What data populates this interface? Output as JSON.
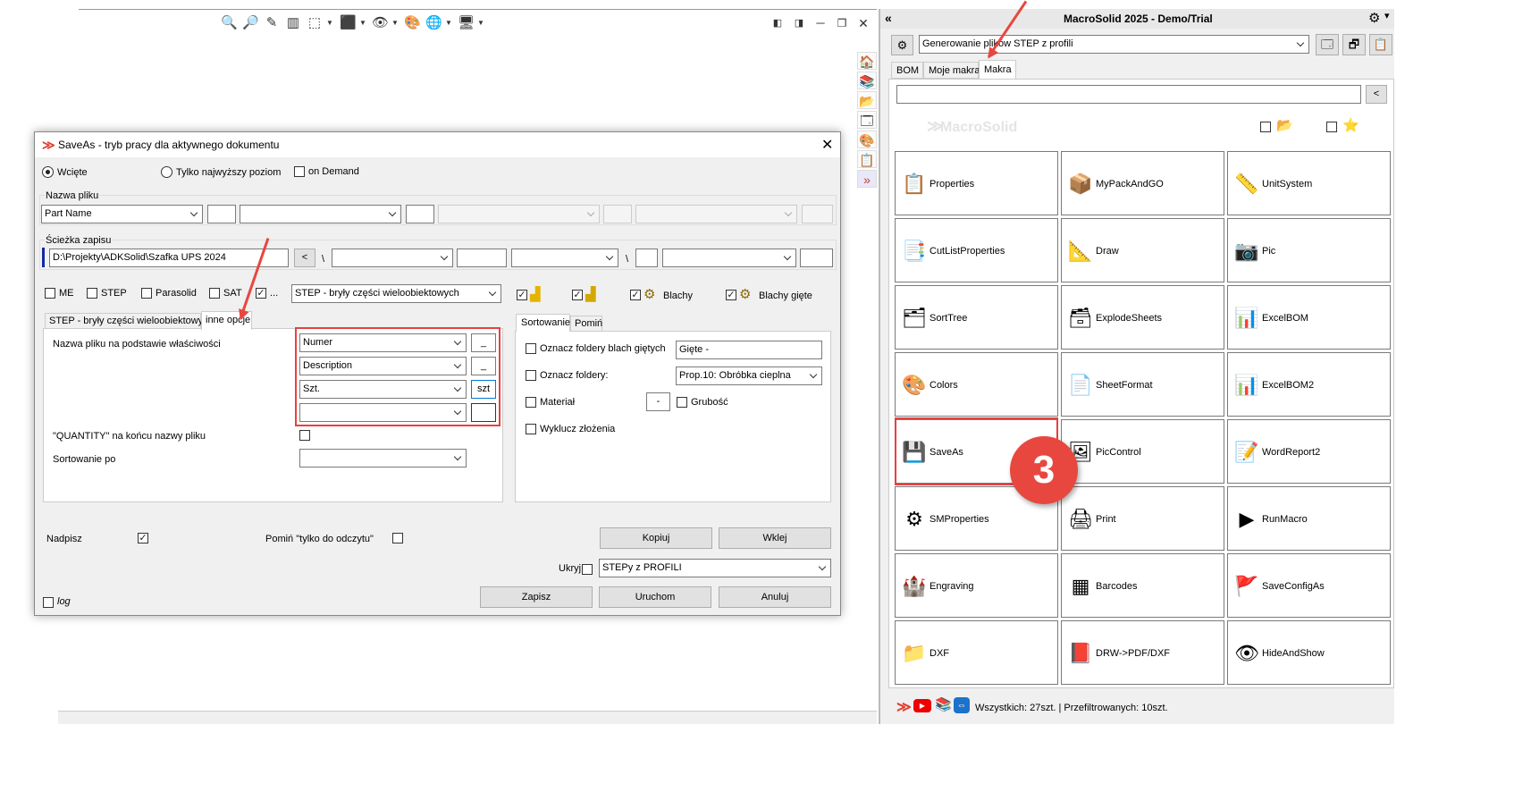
{
  "toolbar": {
    "icons": [
      "zoom-to-fit-icon",
      "zoom-area-icon",
      "previous-view-icon",
      "section-view-icon",
      "view-orientation-icon",
      "display-style-icon",
      "hide-show-icon",
      "edit-appearance-icon",
      "apply-scene-icon",
      "view-settings-icon"
    ]
  },
  "dialog": {
    "title": "SaveAs - tryb pracy dla aktywnego dokumentu",
    "radio_mode": {
      "wciete": "Wcięte",
      "top_level": "Tylko najwyższy poziom",
      "on_demand": "on Demand"
    },
    "file_name": {
      "section_label": "Nazwa pliku",
      "field1": "Part Name"
    },
    "save_path": {
      "section_label": "Ścieżka zapisu",
      "path": "D:\\Projekty\\ADKSolid\\Szafka UPS 2024",
      "back_label": "<",
      "sep": "\\"
    },
    "formats": {
      "me": "ME",
      "step": "STEP",
      "parasolid": "Parasolid",
      "sat": "SAT",
      "more": "...",
      "selected": "STEP - bryły części wieloobiektowych",
      "blachy": "Blachy",
      "blachy_giete": "Blachy gięte"
    },
    "tabs_left": {
      "tab1": "STEP - bryły części wieloobiektowych",
      "tab2": "inne opcje"
    },
    "options": {
      "name_by_props_label": "Nazwa pliku na podstawie właściwości",
      "prop1": "Numer",
      "prop2": "Description",
      "prop3": "Szt.",
      "prop4": "",
      "sep1": "_",
      "sep2": "_",
      "sep3": "szt",
      "sep4": "",
      "quantity_label": "\"QUANTITY\" na końcu nazwy pliku",
      "sort_label": "Sortowanie po",
      "sort_value": ""
    },
    "tabs_right": {
      "tab1": "Sortowanie",
      "tab2": "Pomiń"
    },
    "sorting": {
      "mark_bent": "Oznacz foldery blach giętych",
      "mark_bent_value": "Gięte -",
      "mark_folders": "Oznacz foldery:",
      "mark_folders_value": "Prop.10: Obróbka cieplna",
      "material": "Materiał",
      "dash": "-",
      "thickness": "Grubość",
      "exclude_assemblies": "Wyklucz złożenia"
    },
    "bottom": {
      "overwrite": "Nadpisz",
      "skip_readonly": "Pomiń \"tylko do odczytu\"",
      "copy": "Kopiuj",
      "paste": "Wklej",
      "hide": "Ukryj",
      "preset": "STEPy z PROFILI",
      "save": "Zapisz",
      "run": "Uruchom",
      "cancel": "Anuluj",
      "log": "log"
    }
  },
  "panel": {
    "title": "MacroSolid 2025 - Demo/Trial",
    "macro_select": "Generowanie plików STEP z profili",
    "tabs": [
      "BOM",
      "Moje makra",
      "Makra"
    ],
    "search_value": "",
    "back_label": "<",
    "watermark": "MacroSolid",
    "tiles": [
      {
        "label": "Properties",
        "icon": "properties-icon",
        "glyph": "📋"
      },
      {
        "label": "MyPackAndGO",
        "icon": "pack-and-go-icon",
        "glyph": "📦"
      },
      {
        "label": "UnitSystem",
        "icon": "unit-system-icon",
        "glyph": "📏"
      },
      {
        "label": "CutListProperties",
        "icon": "cut-list-icon",
        "glyph": "📑"
      },
      {
        "label": "Draw",
        "icon": "draw-icon",
        "glyph": "📐"
      },
      {
        "label": "Pic",
        "icon": "camera-icon",
        "glyph": "📷"
      },
      {
        "label": "SortTree",
        "icon": "sort-tree-icon",
        "glyph": "🗂"
      },
      {
        "label": "ExplodeSheets",
        "icon": "explode-sheets-icon",
        "glyph": "🗃"
      },
      {
        "label": "ExcelBOM",
        "icon": "excel-icon",
        "glyph": "📊"
      },
      {
        "label": "Colors",
        "icon": "colors-icon",
        "glyph": "🎨"
      },
      {
        "label": "SheetFormat",
        "icon": "sheet-format-icon",
        "glyph": "📄"
      },
      {
        "label": "ExcelBOM2",
        "icon": "excel2-icon",
        "glyph": "📊"
      },
      {
        "label": "SaveAs",
        "icon": "save-as-icon",
        "glyph": "💾"
      },
      {
        "label": "PicControl",
        "icon": "pic-control-icon",
        "glyph": "🖼"
      },
      {
        "label": "WordReport2",
        "icon": "word-icon",
        "glyph": "📝"
      },
      {
        "label": "SMProperties",
        "icon": "sm-properties-icon",
        "glyph": "⚙"
      },
      {
        "label": "Print",
        "icon": "printer-icon",
        "glyph": "🖨"
      },
      {
        "label": "RunMacro",
        "icon": "run-macro-icon",
        "glyph": "▶"
      },
      {
        "label": "Engraving",
        "icon": "engraving-icon",
        "glyph": "🏰"
      },
      {
        "label": "Barcodes",
        "icon": "barcode-icon",
        "glyph": "▦"
      },
      {
        "label": "SaveConfigAs",
        "icon": "save-config-icon",
        "glyph": "🚩"
      },
      {
        "label": "DXF",
        "icon": "dxf-icon",
        "glyph": "📁"
      },
      {
        "label": "DRW->PDF/DXF",
        "icon": "pdf-icon",
        "glyph": "📕"
      },
      {
        "label": "HideAndShow",
        "icon": "eye-icon",
        "glyph": "👁"
      }
    ],
    "status": "Wszystkich: 27szt. | Przefiltrowanych: 10szt."
  },
  "annotation": {
    "step": "3"
  },
  "colors": {
    "accent_red": "#e8473f",
    "highlight": "#e84040",
    "panel_bg": "#f0f0f0"
  }
}
